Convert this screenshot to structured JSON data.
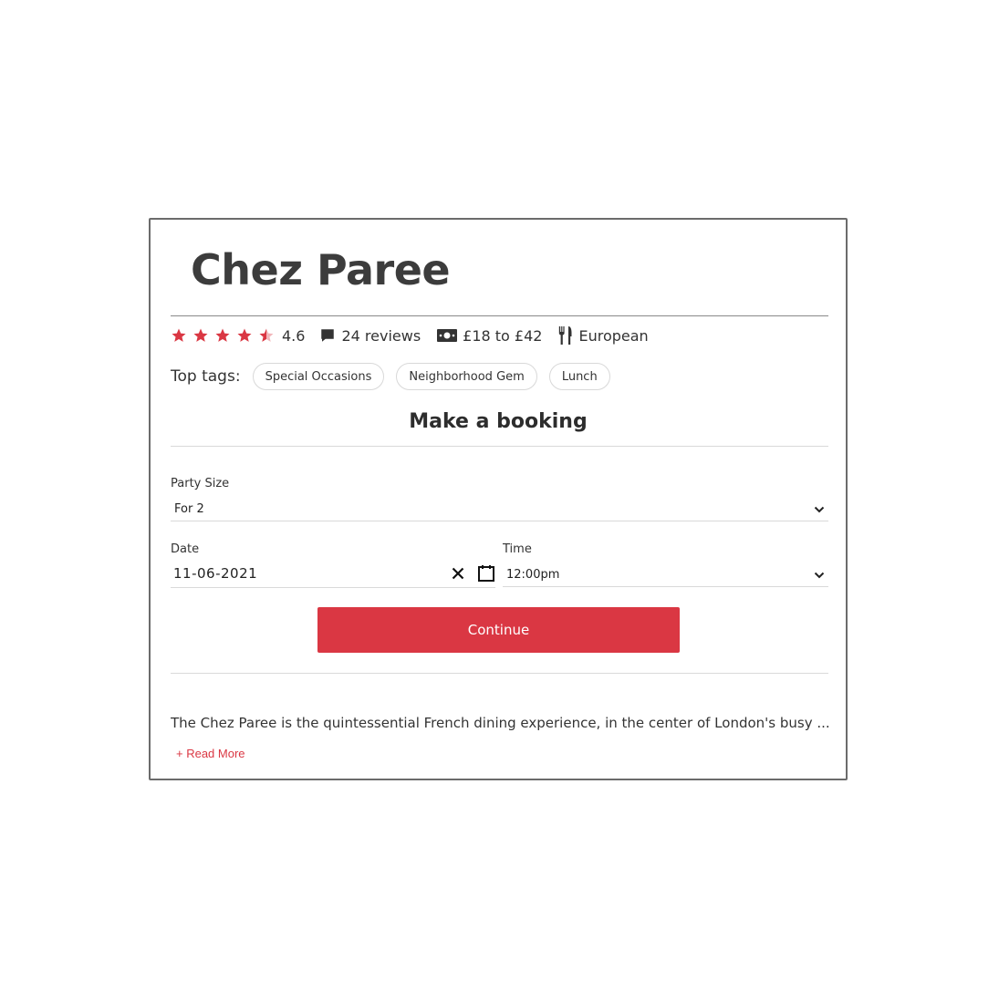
{
  "restaurant": {
    "name": "Chez Paree",
    "rating": "4.6",
    "stars_filled_fraction": 0.92,
    "reviews_label": "24 reviews",
    "price_range": "£18 to £42",
    "cuisine": "European"
  },
  "tags": {
    "label": "Top tags:",
    "items": [
      "Special Occasions",
      "Neighborhood Gem",
      "Lunch"
    ]
  },
  "booking": {
    "title": "Make a booking",
    "party_size_label": "Party Size",
    "party_size_value": "For 2",
    "date_label": "Date",
    "date_value": "11-06-2021",
    "time_label": "Time",
    "time_value": "12:00pm",
    "continue_label": "Continue"
  },
  "about": {
    "description": "The Chez Paree is the quintessential French dining experience, in the center of London's busy ...",
    "read_more_label": "+ Read More"
  },
  "colors": {
    "accent": "#da3743",
    "text": "#333333",
    "border": "#6b6b6b"
  },
  "icons": {
    "star": "star-icon",
    "reviews": "comment-icon",
    "price": "money-icon",
    "cuisine": "fork-knife-icon",
    "clear": "close-icon",
    "calendar": "calendar-icon",
    "dropdown": "chevron-down-icon"
  }
}
